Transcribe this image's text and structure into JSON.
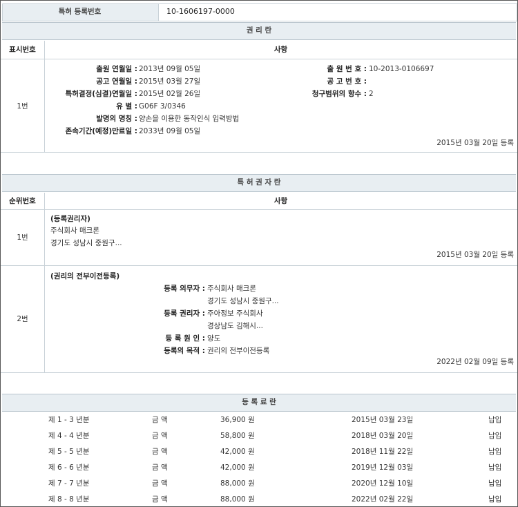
{
  "top": {
    "label": "특허 등록번호",
    "value": "10-1606197-0000"
  },
  "rights": {
    "title": "권 리 란",
    "col_num": "표시번호",
    "col_content": "사항",
    "row": {
      "num": "1번",
      "left_labels": [
        "출원 연월일 :",
        "공고 연월일 :",
        "특허결정(심결)연월일 :",
        "유 별 :",
        "발명의 명칭 :",
        "존속기간(예정)만료일 :"
      ],
      "left_values": [
        "2013년 09월 05일",
        "2015년 03월 27일",
        "2015년 02월 26일",
        "G06F 3/0346",
        "양손을 이용한 동작인식 입력방법",
        "2033년 09월 05일"
      ],
      "right_labels": [
        "출 원 번 호 :",
        "공 고 번 호 :",
        "청구범위의 항수 :"
      ],
      "right_values": [
        "10-2013-0106697",
        "",
        "2"
      ],
      "reg_date": "2015년 03월 20일 등록"
    }
  },
  "owners": {
    "title": "특 허 권 자 란",
    "col_num": "순위번호",
    "col_content": "사항",
    "row1": {
      "num": "1번",
      "heading": "(등록권리자)",
      "lines": [
        "주식회사 매크론",
        "경기도 성남시 중원구..."
      ],
      "reg_date": "2015년 03월 20일 등록"
    },
    "row2": {
      "num": "2번",
      "heading": "(권리의 전부이전등록)",
      "labels": [
        "등록 의무자 :",
        "등록 권리자 :",
        "등 록 원 인 :",
        "등록의 목적 :"
      ],
      "values": [
        "주식회사 매크론",
        "주아정보 주식회사",
        "양도",
        "권리의 전부이전등록"
      ],
      "sub": [
        "경기도 성남시 중원구...",
        "경상남도 김해시..."
      ],
      "reg_date": "2022년 02월 09일 등록"
    }
  },
  "fees": {
    "title": "등 록 료 란",
    "rows": [
      {
        "period": "제 1 - 3 년분",
        "label": "금 액",
        "amount": "36,900 원",
        "date": "2015년 03월 23일",
        "status": "납입"
      },
      {
        "period": "제 4 - 4 년분",
        "label": "금 액",
        "amount": "58,800 원",
        "date": "2018년 03월 20일",
        "status": "납입"
      },
      {
        "period": "제 5 - 5 년분",
        "label": "금 액",
        "amount": "42,000 원",
        "date": "2018년 11월 22일",
        "status": "납입"
      },
      {
        "period": "제 6 - 6 년분",
        "label": "금 액",
        "amount": "42,000 원",
        "date": "2019년 12월 03일",
        "status": "납입"
      },
      {
        "period": "제 7 - 7 년분",
        "label": "금 액",
        "amount": "88,000 원",
        "date": "2020년 12월 10일",
        "status": "납입"
      },
      {
        "period": "제 8 - 8 년분",
        "label": "금 액",
        "amount": "88,000 원",
        "date": "2022년 02월 22일",
        "status": "납입"
      }
    ]
  }
}
